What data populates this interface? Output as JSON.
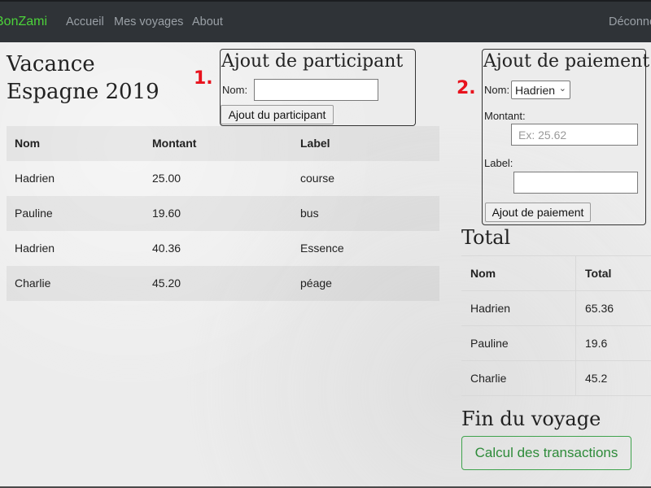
{
  "nav": {
    "brand": "BonZami",
    "links": [
      "Accueil",
      "Mes voyages",
      "About"
    ],
    "logout": "Déconnexion"
  },
  "trip": {
    "title_line1": "Vacance",
    "title_line2": "Espagne 2019"
  },
  "markers": {
    "one": "1.",
    "two": "2."
  },
  "participant_form": {
    "title": "Ajout de participant",
    "nom_label": "Nom:",
    "nom_value": "",
    "button": "Ajout du participant"
  },
  "payment_form": {
    "title": "Ajout de paiement",
    "nom_label": "Nom:",
    "nom_selected": "Hadrien",
    "montant_label": "Montant:",
    "montant_placeholder": "Ex: 25.62",
    "label_label": "Label:",
    "label_value": "",
    "button": "Ajout de paiement"
  },
  "payments_table": {
    "headers": [
      "Nom",
      "Montant",
      "Label"
    ],
    "rows": [
      [
        "Hadrien",
        "25.00",
        "course"
      ],
      [
        "Pauline",
        "19.60",
        "bus"
      ],
      [
        "Hadrien",
        "40.36",
        "Essence"
      ],
      [
        "Charlie",
        "45.20",
        "péage"
      ]
    ]
  },
  "totals": {
    "title": "Total",
    "headers": [
      "Nom",
      "Total"
    ],
    "rows": [
      [
        "Hadrien",
        "65.36"
      ],
      [
        "Pauline",
        "19.6"
      ],
      [
        "Charlie",
        "45.2"
      ]
    ]
  },
  "end": {
    "title": "Fin du voyage",
    "button": "Calcul des transactions"
  },
  "colors": {
    "navbar": "#2f3337",
    "brand": "#4cd23a",
    "marker": "#e8121d",
    "success": "#3fa34d"
  }
}
